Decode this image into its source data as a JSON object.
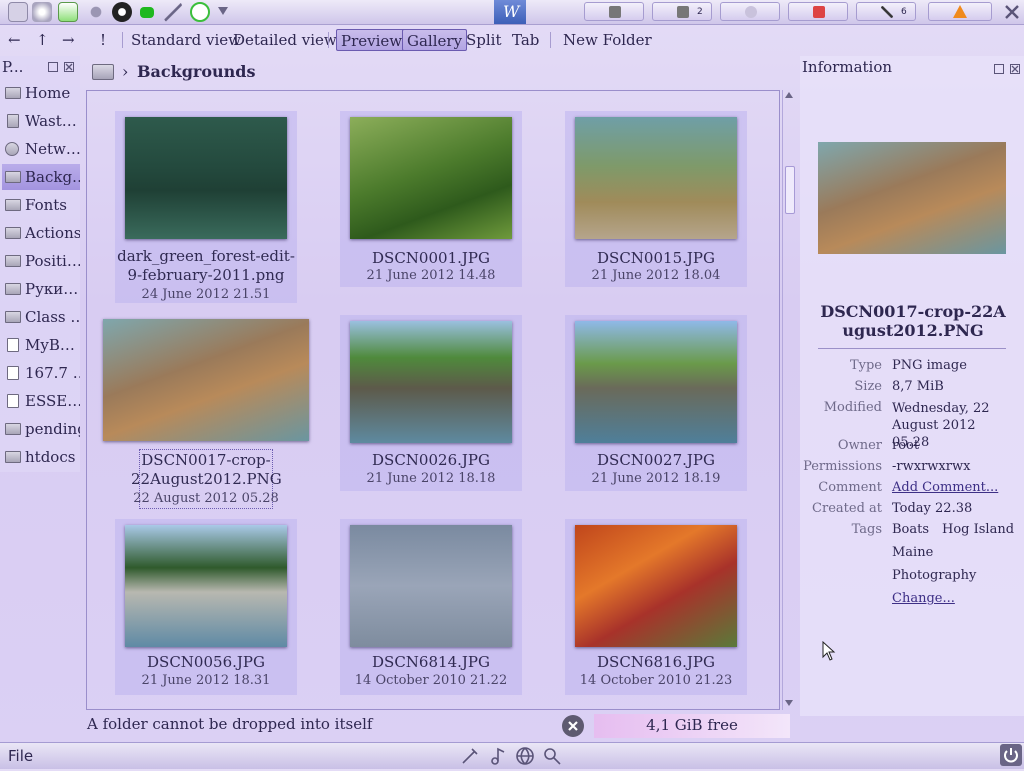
{
  "taskbar": {
    "window_logo": "W",
    "task_badges": [
      "2",
      "6"
    ]
  },
  "toolbar": {
    "back": "←",
    "up": "↑",
    "forward": "→",
    "action": "!",
    "standard_view": "Standard view",
    "detailed_view": "Detailed view",
    "preview": "Preview",
    "gallery": "Gallery",
    "split": "Split",
    "tab": "Tab",
    "new_folder": "New Folder"
  },
  "places": {
    "title": "P...",
    "items": [
      "Home",
      "Wast…",
      "Netw…",
      "Backg…",
      "Fonts",
      "Actions",
      "Positi…",
      "Руки…",
      "Class …",
      "MyB…",
      "167.7 …",
      "ESSE…",
      "pending",
      "htdocs"
    ]
  },
  "breadcrumb": {
    "separator": "›",
    "folder": "Backgrounds"
  },
  "gallery": {
    "items": [
      {
        "name": "dark_green_forest-edit-9-february-2011.png",
        "date": "24 June 2012 21.51"
      },
      {
        "name": "DSCN0001.JPG",
        "date": "21 June 2012 14.48"
      },
      {
        "name": "DSCN0015.JPG",
        "date": "21 June 2012 18.04"
      },
      {
        "name": "DSCN0017-crop-22August2012.PNG",
        "date": "22 August 2012 05.28"
      },
      {
        "name": "DSCN0026.JPG",
        "date": "21 June 2012 18.18"
      },
      {
        "name": "DSCN0027.JPG",
        "date": "21 June 2012 18.19"
      },
      {
        "name": "DSCN0056.JPG",
        "date": "21 June 2012 18.31"
      },
      {
        "name": "DSCN6814.JPG",
        "date": "14 October 2010 21.22"
      },
      {
        "name": "DSCN6816.JPG",
        "date": "14 October 2010 21.23"
      }
    ]
  },
  "info": {
    "title": "Information",
    "file_name": "DSCN0017-crop-22August2012.PNG",
    "type_label": "Type",
    "type": "PNG image",
    "size_label": "Size",
    "size": "8,7 MiB",
    "modified_label": "Modified",
    "modified": "Wednesday, 22 August 2012 05.28",
    "owner_label": "Owner",
    "owner": "root",
    "permissions_label": "Permissions",
    "permissions": "-rwxrwxrwx",
    "comment_label": "Comment",
    "comment_link": "Add Comment...",
    "created_label": "Created at",
    "created": "Today 22.38",
    "tags_label": "Tags",
    "tags": [
      "Boats",
      "Hog Island",
      "Maine",
      "Photography"
    ],
    "tags_change": "Change..."
  },
  "status": {
    "message": "A folder cannot be dropped into itself",
    "free_space": "4,1 GiB free"
  },
  "bottom_panel": {
    "file_menu": "File"
  }
}
